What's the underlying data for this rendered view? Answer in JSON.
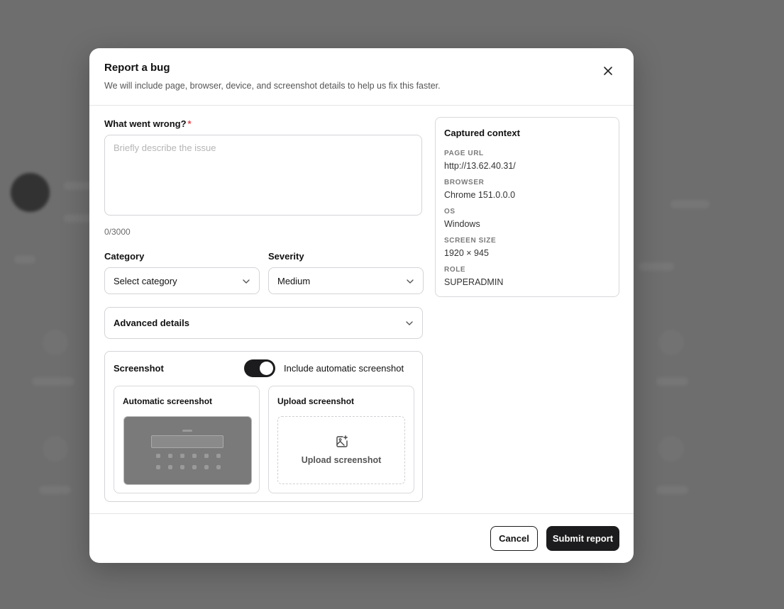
{
  "modal": {
    "title": "Report a bug",
    "subtitle": "We will include page, browser, device, and screenshot details to help us fix this faster."
  },
  "form": {
    "what_label": "What went wrong?",
    "required_mark": "*",
    "description_placeholder": "Briefly describe the issue",
    "description_value": "",
    "counter": "0/3000",
    "category_label": "Category",
    "category_value": "Select category",
    "severity_label": "Severity",
    "severity_value": "Medium",
    "advanced_label": "Advanced details"
  },
  "screenshot": {
    "title": "Screenshot",
    "toggle_label": "Include automatic screenshot",
    "toggle_on": true,
    "auto_title": "Automatic screenshot",
    "upload_title": "Upload screenshot",
    "upload_button_label": "Upload screenshot"
  },
  "context": {
    "title": "Captured context",
    "page_url_key": "PAGE URL",
    "page_url": "http://13.62.40.31/",
    "browser_key": "BROWSER",
    "browser": "Chrome 151.0.0.0",
    "os_key": "OS",
    "os": "Windows",
    "screen_key": "SCREEN SIZE",
    "screen": "1920 × 945",
    "role_key": "ROLE",
    "role": "SUPERADMIN"
  },
  "footer": {
    "cancel_label": "Cancel",
    "submit_label": "Submit report"
  },
  "colors": {
    "primary": "#1c1c1e",
    "required": "#e5484d",
    "overlay": "#6e6e6e"
  }
}
